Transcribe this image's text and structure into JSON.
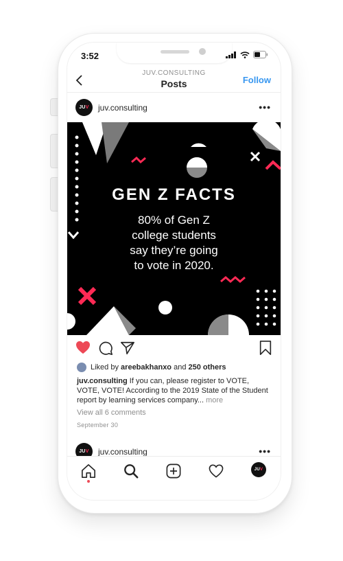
{
  "status_bar": {
    "time": "3:52"
  },
  "nav": {
    "subtitle": "JUV.CONSULTING",
    "title": "Posts",
    "back_icon": "chevron-left-icon",
    "follow_label": "Follow"
  },
  "post": {
    "avatar_text": {
      "j": "JU",
      "v": "V"
    },
    "username": "juv.consulting",
    "more_icon": "•••",
    "image": {
      "title": "GEN Z FACTS",
      "lines": [
        "80% of Gen Z",
        "college students",
        "say they’re going",
        "to vote in 2020."
      ],
      "accent_color": "#ff2a55"
    },
    "liked_by": {
      "prefix": "Liked by ",
      "user": "areebakhanxo",
      "and": " and ",
      "others": "250 others"
    },
    "caption": {
      "user": "juv.consulting",
      "text": " If you can, please register to VOTE, VOTE, VOTE! According to the 2019 State of the Student report by learning services company...",
      "more": " more"
    },
    "view_comments": "View all 6 comments",
    "date": "September 30"
  },
  "next_post": {
    "username": "juv.consulting",
    "more_icon": "•••"
  },
  "colors": {
    "like_red": "#ed4956",
    "follow_blue": "#3897f0"
  }
}
